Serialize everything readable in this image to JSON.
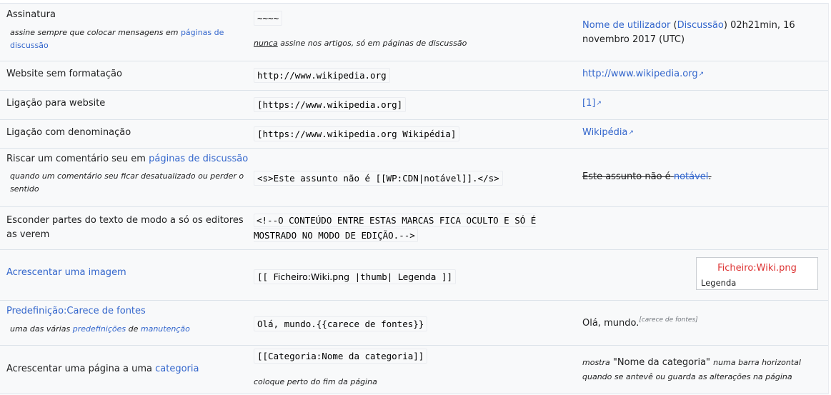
{
  "rows": {
    "signature": {
      "label": "Assinatura",
      "note_pre": "assine sempre que colocar mensagens em",
      "note_link": "páginas de discussão",
      "code": "~~~~",
      "code_note_under": "nunca",
      "code_note_rest": "assine nos artigos, só em páginas de discussão",
      "result_user": "Nome de utilizador",
      "result_paren_open": "(",
      "result_talk": "Discussão",
      "result_paren_close": ")",
      "result_date": "02h21min, 16 novembro 2017 (UTC)"
    },
    "plain_url": {
      "label": "Website sem formatação",
      "code": "http://www.wikipedia.org",
      "result": "http://www.wikipedia.org"
    },
    "link_url": {
      "label": "Ligação para website",
      "code": "[https://www.wikipedia.org]",
      "result": "[1]"
    },
    "named_link": {
      "label": "Ligação com denominação",
      "code": "[https://www.wikipedia.org Wikipédia]",
      "result": "Wikipédia"
    },
    "strike": {
      "label_pre": "Riscar um comentário seu em",
      "label_link": "páginas de discussão",
      "note": "quando um comentário seu ficar desatualizado ou perder o sentido",
      "code": "<s>Este assunto não é [[WP:CDN|notável]].</s>",
      "result_text": "Este assunto não é",
      "result_link": "notável",
      "result_end": "."
    },
    "hide": {
      "label": "Esconder partes do texto de modo a só os editores as verem",
      "code": "<!--O CONTEÚDO ENTRE ESTAS MARCAS FICA OCULTO E SÓ É MOSTRADO NO MODO DE EDIÇÃO.-->"
    },
    "image": {
      "label": "Acrescentar uma imagem",
      "code_open": "[[",
      "code_file": "Ficheiro:Wiki.png",
      "code_sep1": "|",
      "code_thumb": "thumb",
      "code_sep2": "|",
      "code_caption": "Legenda",
      "code_close": "]]",
      "thumb_file": "Ficheiro:Wiki.png",
      "thumb_caption": "Legenda"
    },
    "template": {
      "label": "Predefinição:Carece de fontes",
      "note_pre": "uma das várias",
      "note_link1": "predefinições",
      "note_mid": "de",
      "note_link2": "manutenção",
      "code": "Olá, mundo.{{carece de fontes}}",
      "result_text": "Olá, mundo.",
      "result_sup": "[carece de fontes]"
    },
    "category": {
      "label_pre": "Acrescentar uma página a uma",
      "label_link": "categoria",
      "code": "[[Categoria:Nome da categoria]]",
      "code_note": "coloque perto do fim da página",
      "result_pre": "mostra",
      "result_name": "\"Nome da categoria\"",
      "result_rest": "numa barra horizontal quando se antevê ou guarda as alterações na página"
    }
  }
}
